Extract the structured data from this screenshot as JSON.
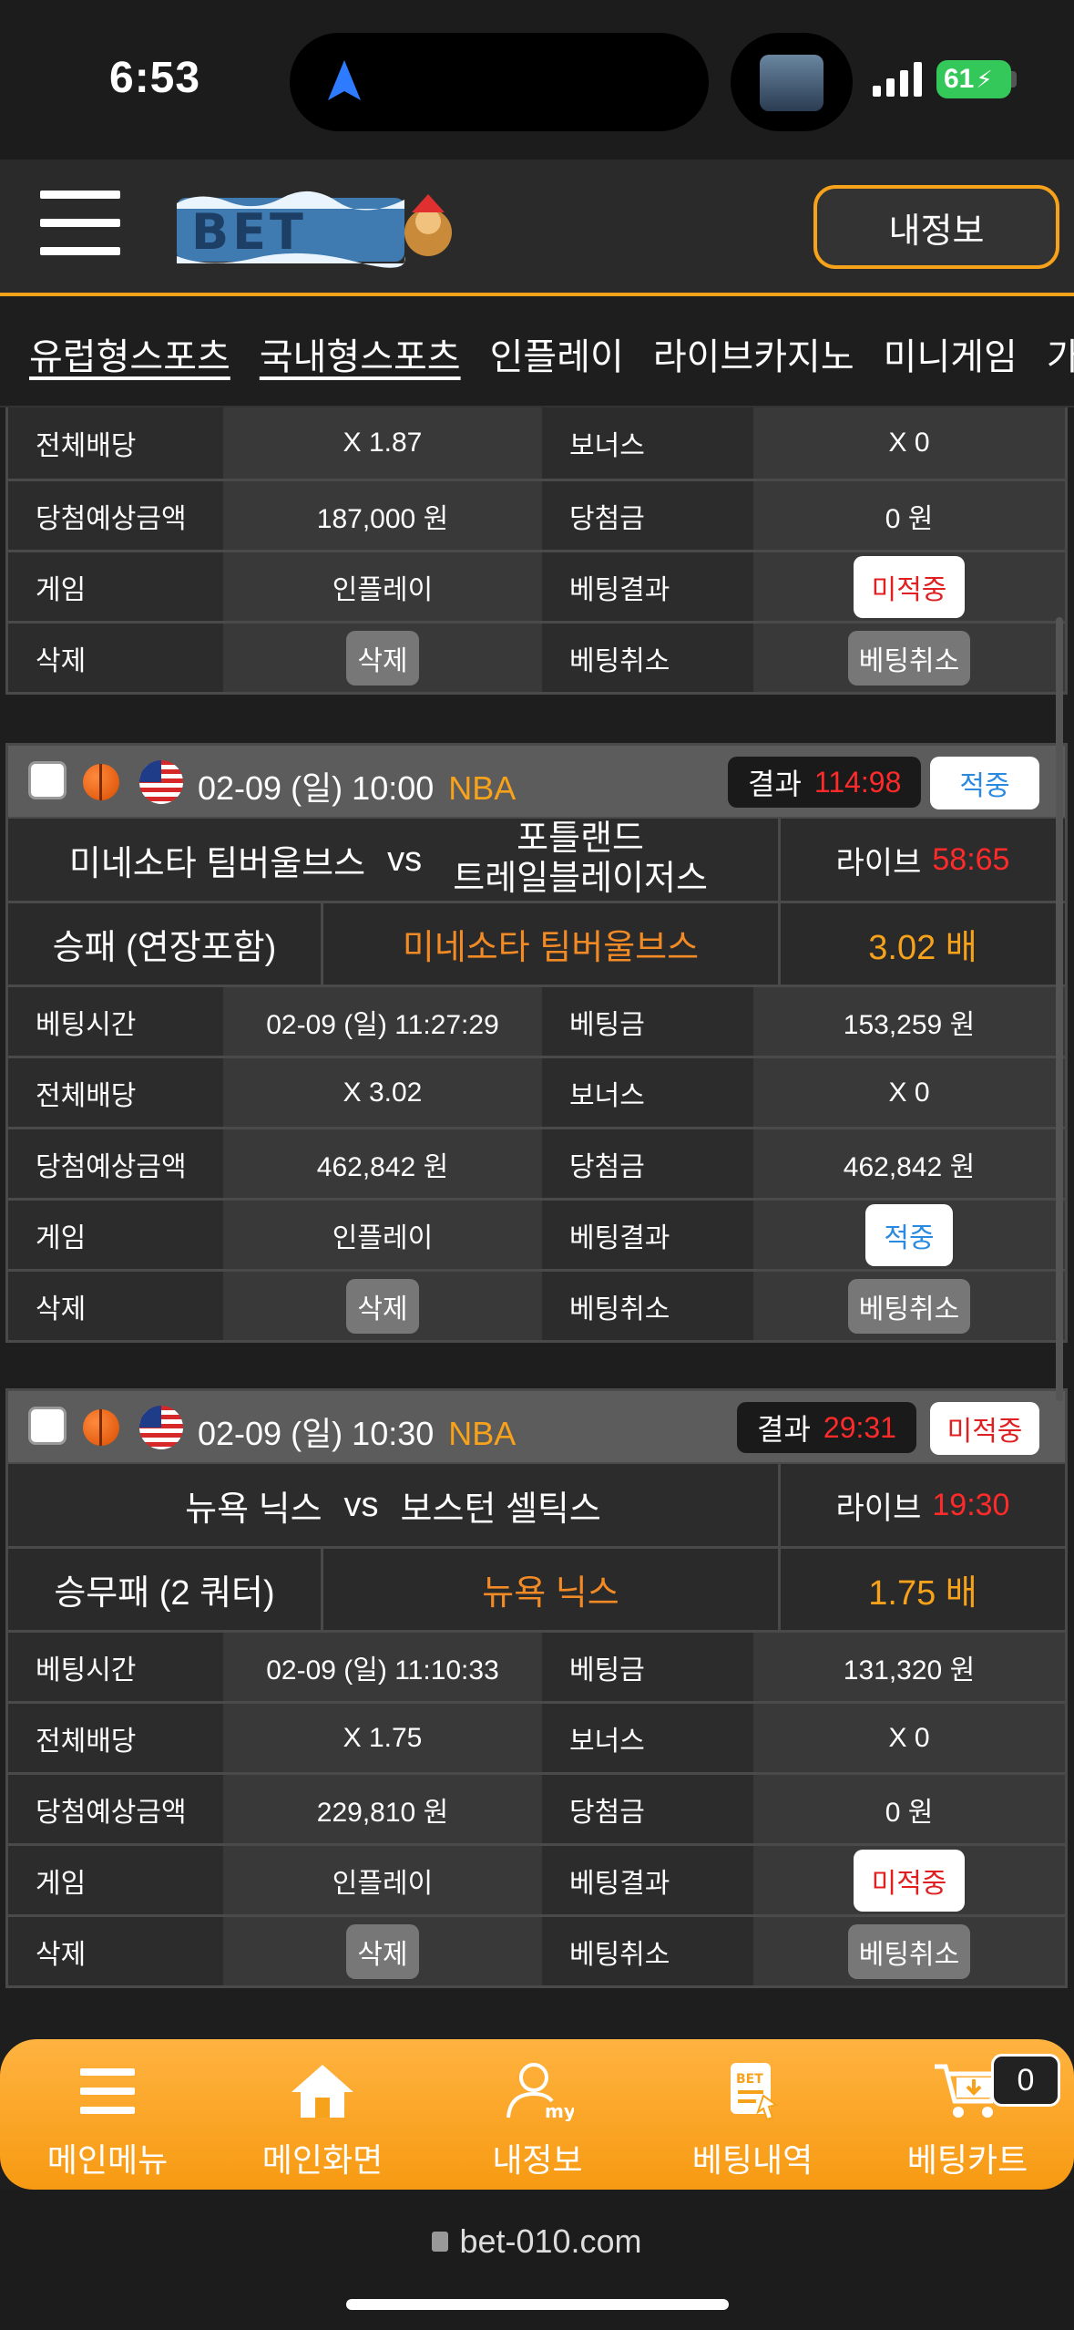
{
  "status_bar": {
    "time": "6:53",
    "battery": "61"
  },
  "header": {
    "myinfo_label": "내정보"
  },
  "nav_tabs": [
    "유럽형스포츠",
    "국내형스포츠",
    "인플레이",
    "라이브카지노",
    "미니게임",
    "가상게임"
  ],
  "partial_card": {
    "rows": [
      {
        "l1": "전체배당",
        "v1": "X 1.87",
        "l2": "보너스",
        "v2": "X 0"
      },
      {
        "l1": "당첨예상금액",
        "v1": "187,000 원",
        "l2": "당첨금",
        "v2": "0 원"
      },
      {
        "l1": "게임",
        "v1": "인플레이",
        "l2": "베팅결과",
        "v2": "미적중"
      },
      {
        "l1": "삭제",
        "v1": "삭제",
        "l2": "베팅취소",
        "v2": "베팅취소"
      }
    ]
  },
  "bets": [
    {
      "datetime": "02-09 (일) 10:00",
      "league": "NBA",
      "result_label": "결과",
      "result_score": "114:98",
      "status": "적중",
      "home": "미네소타 팀버울브스",
      "vs": "vs",
      "away_line1": "포틀랜드",
      "away_line2": "트레일블레이저스",
      "live_label": "라이브",
      "live_score": "58:65",
      "market": "승패 (연장포함)",
      "selection": "미네소타 팀버울브스",
      "odds": "3.02 배",
      "rows": [
        {
          "l1": "베팅시간",
          "v1": "02-09 (일) 11:27:29",
          "l2": "베팅금",
          "v2": "153,259 원"
        },
        {
          "l1": "전체배당",
          "v1": "X 3.02",
          "l2": "보너스",
          "v2": "X 0"
        },
        {
          "l1": "당첨예상금액",
          "v1": "462,842 원",
          "l2": "당첨금",
          "v2": "462,842 원"
        },
        {
          "l1": "게임",
          "v1": "인플레이",
          "l2": "베팅결과",
          "v2": "적중"
        },
        {
          "l1": "삭제",
          "v1": "삭제",
          "l2": "베팅취소",
          "v2": "베팅취소"
        }
      ]
    },
    {
      "datetime": "02-09 (일) 10:30",
      "league": "NBA",
      "result_label": "결과",
      "result_score": "29:31",
      "status": "미적중",
      "home": "뉴욕 닉스",
      "vs": "vs",
      "away_line1": "보스턴 셀틱스",
      "away_line2": "",
      "live_label": "라이브",
      "live_score": "19:30",
      "market": "승무패 (2 쿼터)",
      "selection": "뉴욕 닉스",
      "odds": "1.75 배",
      "rows": [
        {
          "l1": "베팅시간",
          "v1": "02-09 (일) 11:10:33",
          "l2": "베팅금",
          "v2": "131,320 원"
        },
        {
          "l1": "전체배당",
          "v1": "X 1.75",
          "l2": "보너스",
          "v2": "X 0"
        },
        {
          "l1": "당첨예상금액",
          "v1": "229,810 원",
          "l2": "당첨금",
          "v2": "0 원"
        },
        {
          "l1": "게임",
          "v1": "인플레이",
          "l2": "베팅결과",
          "v2": "미적중"
        },
        {
          "l1": "삭제",
          "v1": "삭제",
          "l2": "베팅취소",
          "v2": "베팅취소"
        }
      ]
    }
  ],
  "bottom_nav": {
    "items": [
      {
        "label": "메인메뉴",
        "icon": "menu-icon"
      },
      {
        "label": "메인화면",
        "icon": "home-icon"
      },
      {
        "label": "내정보",
        "icon": "user-icon"
      },
      {
        "label": "베팅내역",
        "icon": "bet-history-icon"
      },
      {
        "label": "베팅카트",
        "icon": "cart-icon"
      }
    ],
    "cart_count": "0"
  },
  "browser": {
    "url": "bet-010.com"
  },
  "colors": {
    "accent": "#f7a21b",
    "win": "#2a8ae0",
    "lose": "#e02020",
    "score": "#ff2a2a"
  }
}
